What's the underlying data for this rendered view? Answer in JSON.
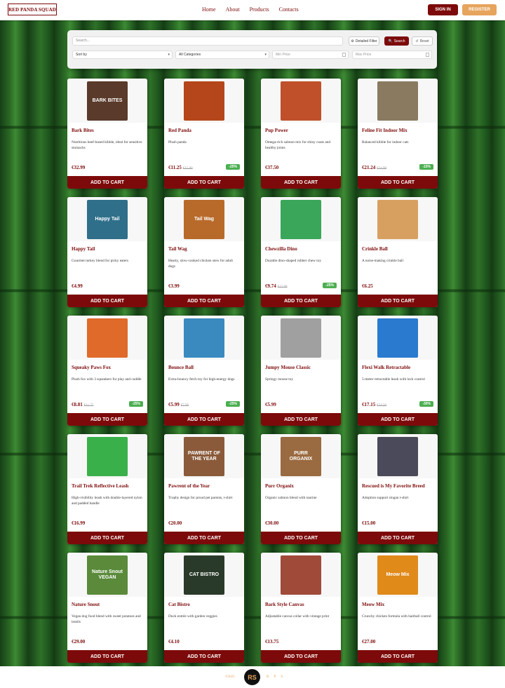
{
  "header": {
    "logo": "RED PANDA SQUAD",
    "nav": [
      "Home",
      "About",
      "Products",
      "Contacts"
    ],
    "sign_in": "SIGN IN",
    "register": "REGISTER"
  },
  "filter": {
    "search_placeholder": "Search...",
    "detailed_filter": "Detailed Filter",
    "search": "Search",
    "reset": "Reset",
    "sort_by": "Sort by",
    "category": "All Categories",
    "min_price": "Min Price",
    "max_price": "Max Price"
  },
  "cart_label": "ADD TO CART",
  "products": [
    {
      "name": "Bark Bites",
      "desc": "Nutritious beef-based kibble, ideal for sensitive stomachs",
      "price": "€32.99",
      "old": "",
      "badge": "",
      "img": "BARK BITES",
      "color": "#5a3a2a"
    },
    {
      "name": "Red Panda",
      "desc": "Plush panda",
      "price": "€11.25",
      "old": "€15.00",
      "badge": "-25%",
      "img": "",
      "color": "#b5451b"
    },
    {
      "name": "Pup Power",
      "desc": "Omega-rich salmon mix for shiny coats and healthy joints",
      "price": "€37.50",
      "old": "",
      "badge": "",
      "img": "",
      "color": "#c0502a"
    },
    {
      "name": "Feline Fit Indoor Mix",
      "desc": "Balanced kibble for indoor cats",
      "price": "€21.24",
      "old": "€24.99",
      "badge": "-15%",
      "img": "",
      "color": "#8a7a60"
    },
    {
      "name": "Happy Tail",
      "desc": "Gourmet turkey blend for picky eaters",
      "price": "€4.99",
      "old": "",
      "badge": "",
      "img": "Happy Tail",
      "color": "#2f6f8a"
    },
    {
      "name": "Tail Wag",
      "desc": "Hearty, slow-cooked chicken stew for adult dogs",
      "price": "€3.99",
      "old": "",
      "badge": "",
      "img": "Tail Wag",
      "color": "#b86a2a"
    },
    {
      "name": "Chewzilla Dino",
      "desc": "Durable dino-shaped rubber chew toy",
      "price": "€9.74",
      "old": "€12.99",
      "badge": "-25%",
      "img": "",
      "color": "#3aa65a"
    },
    {
      "name": "Crinkle Ball",
      "desc": "A noise-making crinkle ball",
      "price": "€6.25",
      "old": "",
      "badge": "",
      "img": "",
      "color": "#d8a060"
    },
    {
      "name": "Squeaky Paws Fox",
      "desc": "Plush fox with 3 squeakers for play and cuddle",
      "price": "€8.81",
      "old": "€11.75",
      "badge": "-25%",
      "img": "",
      "color": "#e06a2a"
    },
    {
      "name": "Bounce Ball",
      "desc": "Extra-bouncy fetch toy for high-energy dogs",
      "price": "€5.99",
      "old": "€7.99",
      "badge": "-25%",
      "img": "",
      "color": "#3a8ac0"
    },
    {
      "name": "Jumpy Mouse Classic",
      "desc": "Springy mouse toy",
      "price": "€5.99",
      "old": "",
      "badge": "",
      "img": "",
      "color": "#a0a0a0"
    },
    {
      "name": "Flexi Walk Retractable",
      "desc": "5-meter retractable leash with lock control",
      "price": "€17.15",
      "old": "€24.50",
      "badge": "-30%",
      "img": "",
      "color": "#2a7ad0"
    },
    {
      "name": "Trail Trek Reflective Leash",
      "desc": "High-visibility leash with double-layered nylon and padded handle",
      "price": "€16.99",
      "old": "",
      "badge": "",
      "img": "",
      "color": "#3ab04a"
    },
    {
      "name": "Pawrent of the Year",
      "desc": "Trophy design for proud pet parents, t-shirt",
      "price": "€20.00",
      "old": "",
      "badge": "",
      "img": "PAWRENT OF THE YEAR",
      "color": "#8a5a3a"
    },
    {
      "name": "Purr Organix",
      "desc": "Organic salmon blend with taurine",
      "price": "€30.00",
      "old": "",
      "badge": "",
      "img": "PURR ORGANIX",
      "color": "#9a6a40"
    },
    {
      "name": "Rescued is My Favorite Breed",
      "desc": "Adoption support slogan t-shirt",
      "price": "€15.00",
      "old": "",
      "badge": "",
      "img": "",
      "color": "#4a4a5a"
    },
    {
      "name": "Nature Snout",
      "desc": "Vegan dog food blend with sweet potatoes and lentils",
      "price": "€29.00",
      "old": "",
      "badge": "",
      "img": "Nature Snout VEGAN",
      "color": "#5a8a3a"
    },
    {
      "name": "Cat Bistro",
      "desc": "Duck entrée with garden veggies",
      "price": "€4.10",
      "old": "",
      "badge": "",
      "img": "CAT BISTRO",
      "color": "#2a3a2a"
    },
    {
      "name": "Bark Style Canvas",
      "desc": "Adjustable canvas collar with vintage print",
      "price": "€13.75",
      "old": "",
      "badge": "",
      "img": "",
      "color": "#a04a3a"
    },
    {
      "name": "Meow Mix",
      "desc": "Crunchy chicken formula with hairball control",
      "price": "€27.00",
      "old": "",
      "badge": "",
      "img": "Meow Mix",
      "color": "#e08a1a"
    }
  ],
  "footer": {
    "copyright": "©2025",
    "logo": "RS",
    "tag": "R P S"
  }
}
